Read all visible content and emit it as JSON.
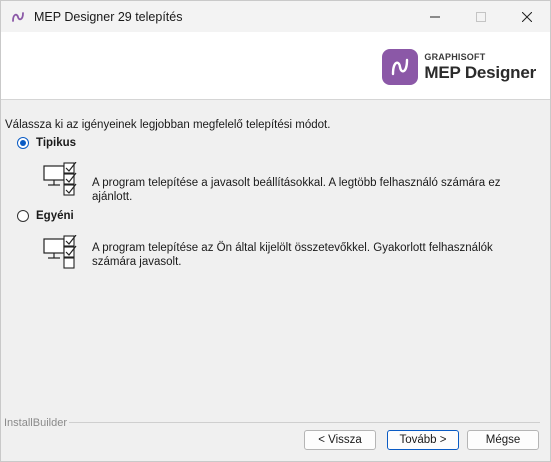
{
  "window": {
    "title": "MEP Designer 29 telepítés",
    "controls": [
      "minimize-icon",
      "maximize-icon",
      "close-icon"
    ]
  },
  "header": {
    "logo_brand": "GRAPHISOFT",
    "logo_product": "MEP Designer",
    "logo_color": "#8b58a7"
  },
  "content": {
    "intro": "Válassza ki az igényeinek legjobban megfelelő telepítési módot.",
    "options": [
      {
        "label": "Tipikus",
        "selected": true,
        "icon": "monitor-checklist-icon",
        "description": "A program telepítése a javasolt beállításokkal. A legtöbb felhasználó számára ez ajánlott."
      },
      {
        "label": "Egyéni",
        "selected": false,
        "icon": "monitor-checklist-icon",
        "description": "A program telepítése az Ön által kijelölt összetevőkkel. Gyakorlott felhasználók számára javasolt."
      }
    ]
  },
  "footer": {
    "installbuilder": "InstallBuilder",
    "back_label": "< Vissza",
    "next_label": "Tovább >",
    "cancel_label": "Mégse",
    "accent": "#0a5bc4"
  }
}
